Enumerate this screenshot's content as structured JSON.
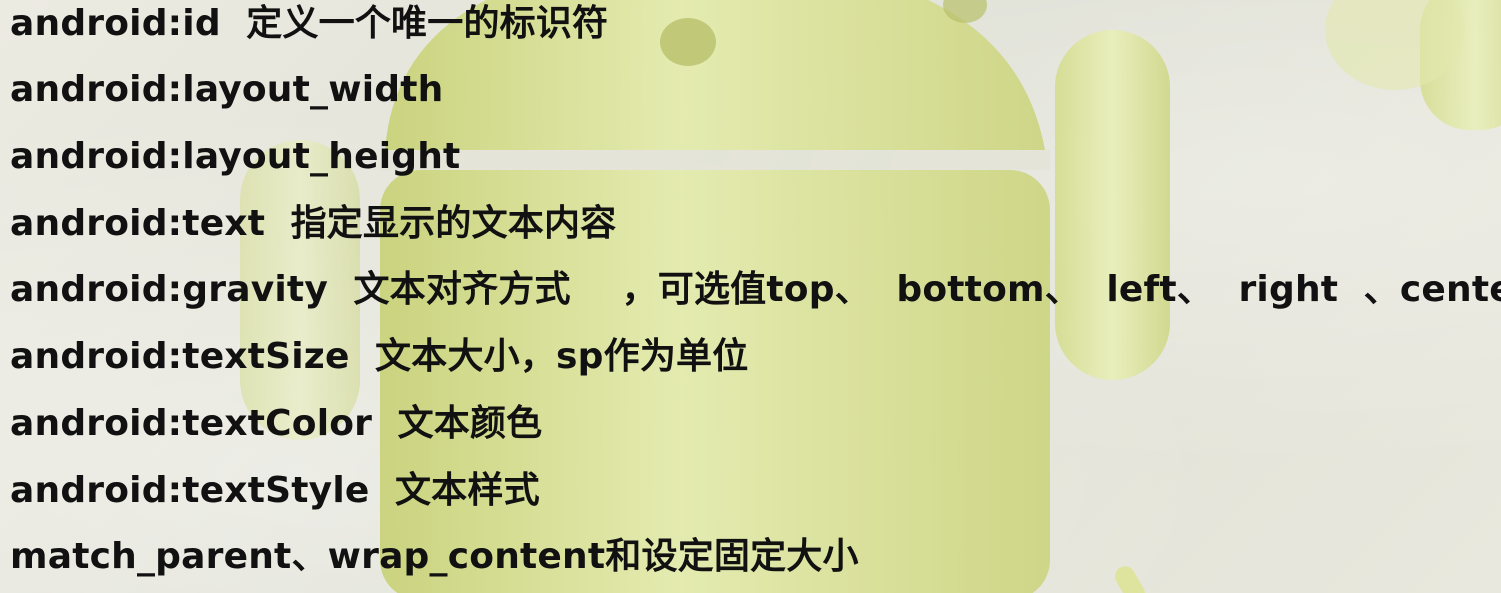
{
  "lines": [
    "android:id  定义一个唯一的标识符",
    "android:layout_width",
    "android:layout_height",
    "android:text  指定显示的文本内容",
    "android:gravity  文本对齐方式    ，可选值top、  bottom、  left、  right  、center",
    "android:textSize  文本大小，sp作为单位",
    "android:textColor  文本颜色",
    "android:textStyle  文本样式",
    "match_parent、wrap_content和设定固定大小"
  ],
  "colors": {
    "text": "#111111",
    "robot": "#d7e08c",
    "background": "#e6e6dc"
  },
  "icons": {
    "background_art": "android-robot-icon"
  }
}
